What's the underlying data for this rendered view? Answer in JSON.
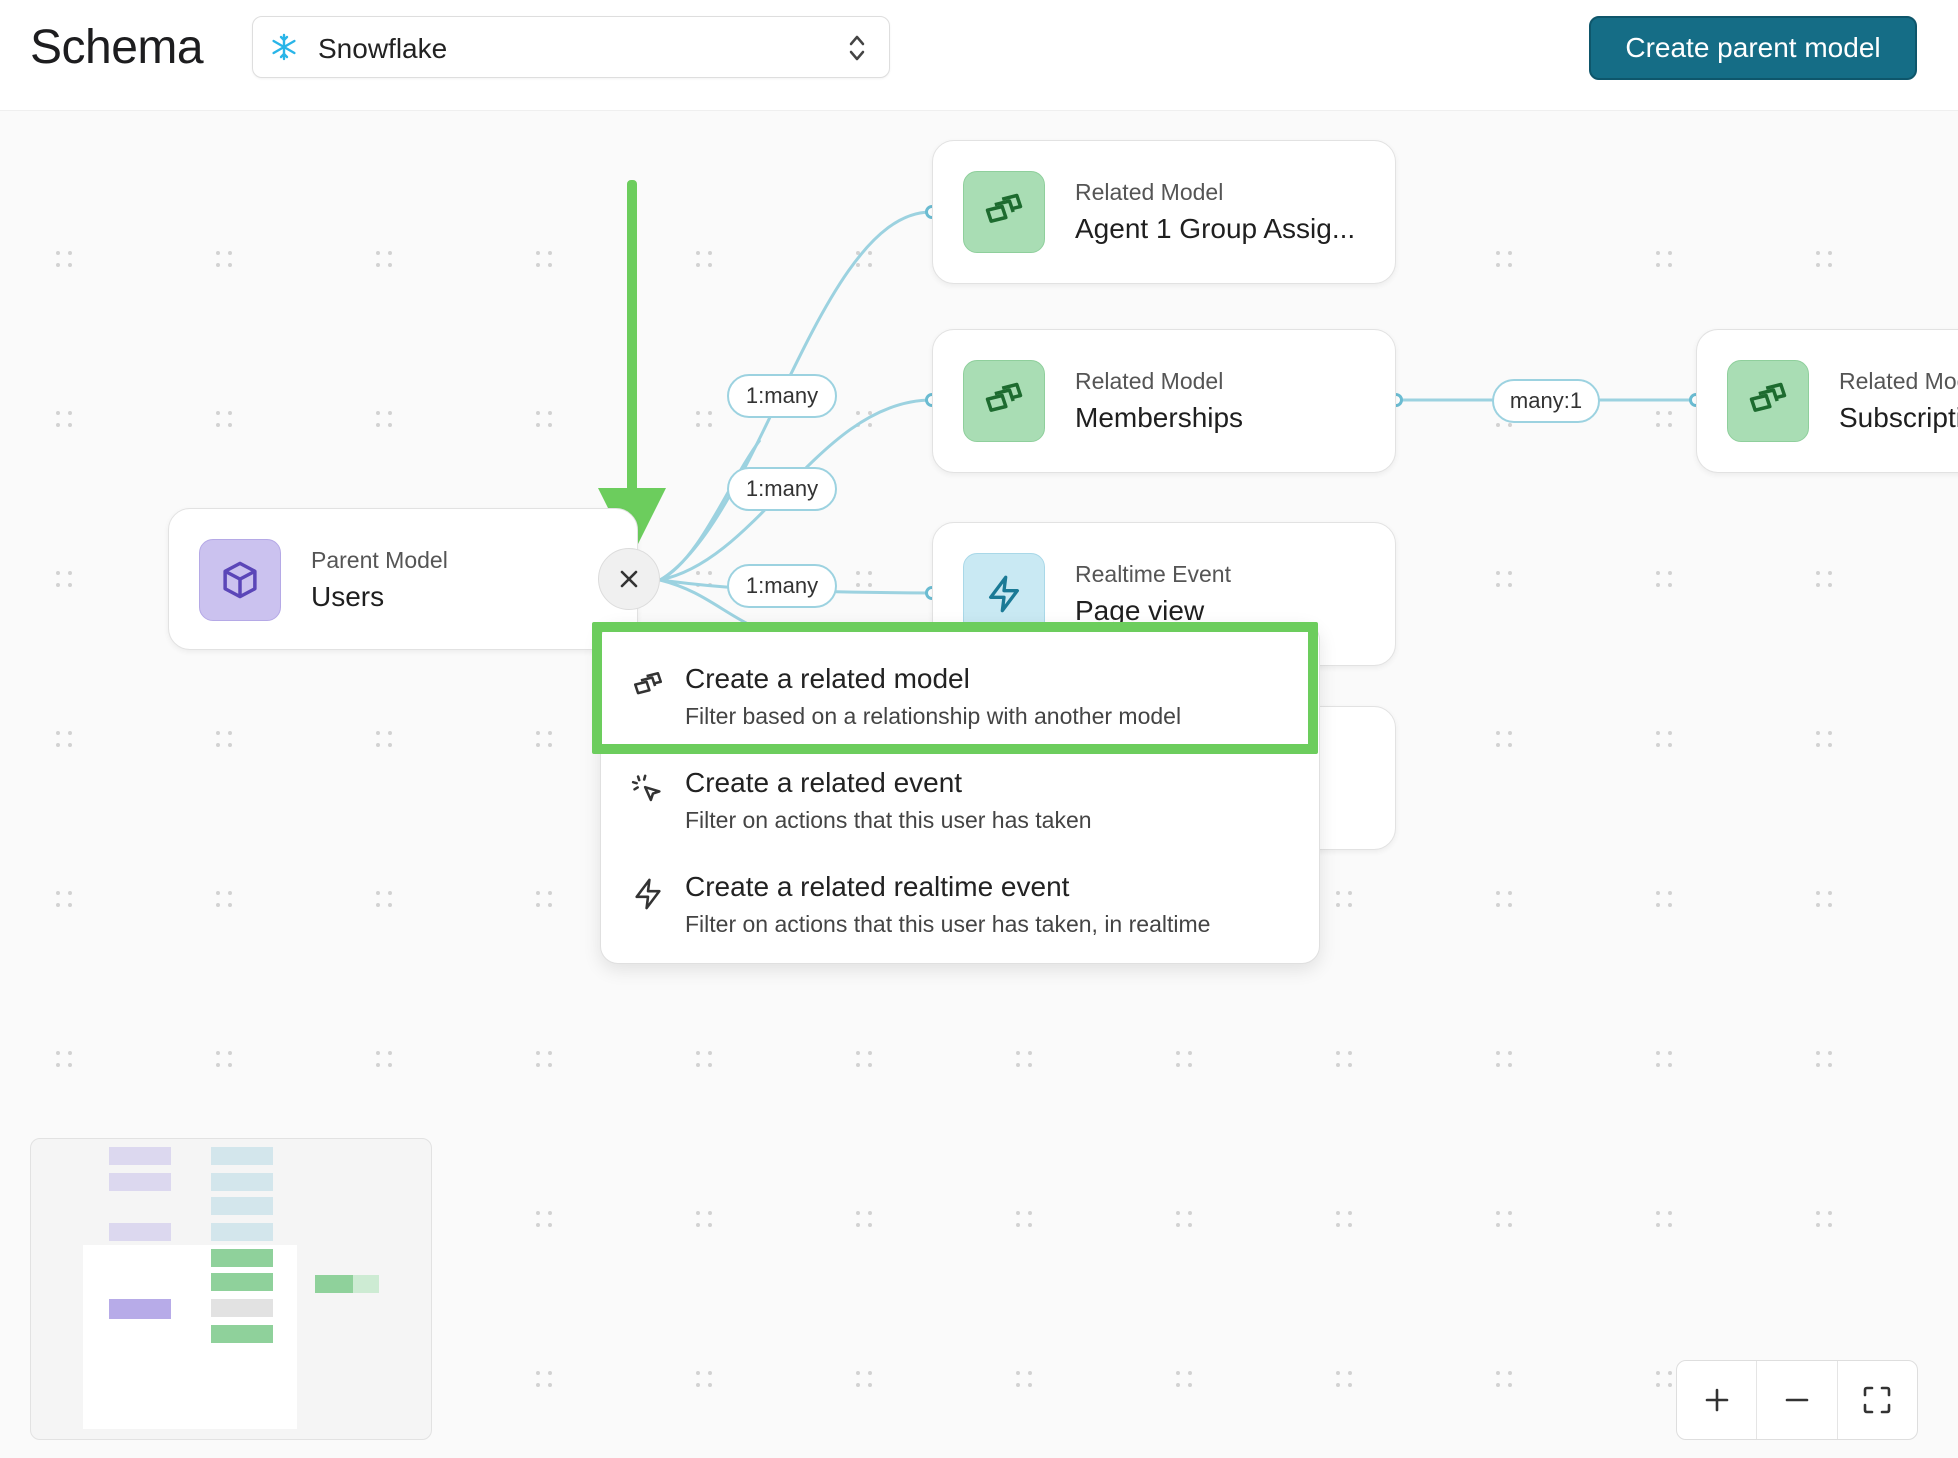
{
  "header": {
    "title": "Schema",
    "source": {
      "label": "Snowflake",
      "icon": "snowflake-icon"
    },
    "create_parent_model_label": "Create parent model"
  },
  "nodes": {
    "parent": {
      "kind": "Parent Model",
      "name": "Users",
      "icon": "cube-icon"
    },
    "agent": {
      "kind": "Related Model",
      "name": "Agent 1 Group Assig...",
      "icon": "models-icon"
    },
    "memberships": {
      "kind": "Related Model",
      "name": "Memberships",
      "icon": "models-icon"
    },
    "subscriptions": {
      "kind": "Related Moc",
      "name": "Subscriptio",
      "icon": "models-icon"
    },
    "pageview": {
      "kind": "Realtime Event",
      "name": "Page view",
      "icon": "bolt-icon"
    }
  },
  "relations": {
    "agent": "1:many",
    "memberships": "1:many",
    "pageview": "1:many",
    "subscriptions": "many:1"
  },
  "menu": {
    "items": [
      {
        "title": "Create a related model",
        "description": "Filter based on a relationship with another model",
        "icon": "models-icon"
      },
      {
        "title": "Create a related event",
        "description": "Filter on actions that this user has taken",
        "icon": "cursor-click-icon"
      },
      {
        "title": "Create a related realtime event",
        "description": "Filter on actions that this user has taken, in realtime",
        "icon": "bolt-icon"
      }
    ]
  },
  "colors": {
    "primary": "#156d86",
    "highlight": "#6ccd5d",
    "edge": "#9cd2e0",
    "model_green": "#a9ddb4",
    "parent_purple": "#cbc2ef"
  },
  "zoom_controls": {
    "zoom_in": "+",
    "zoom_out": "−",
    "fit_view": "fit-view-icon"
  }
}
